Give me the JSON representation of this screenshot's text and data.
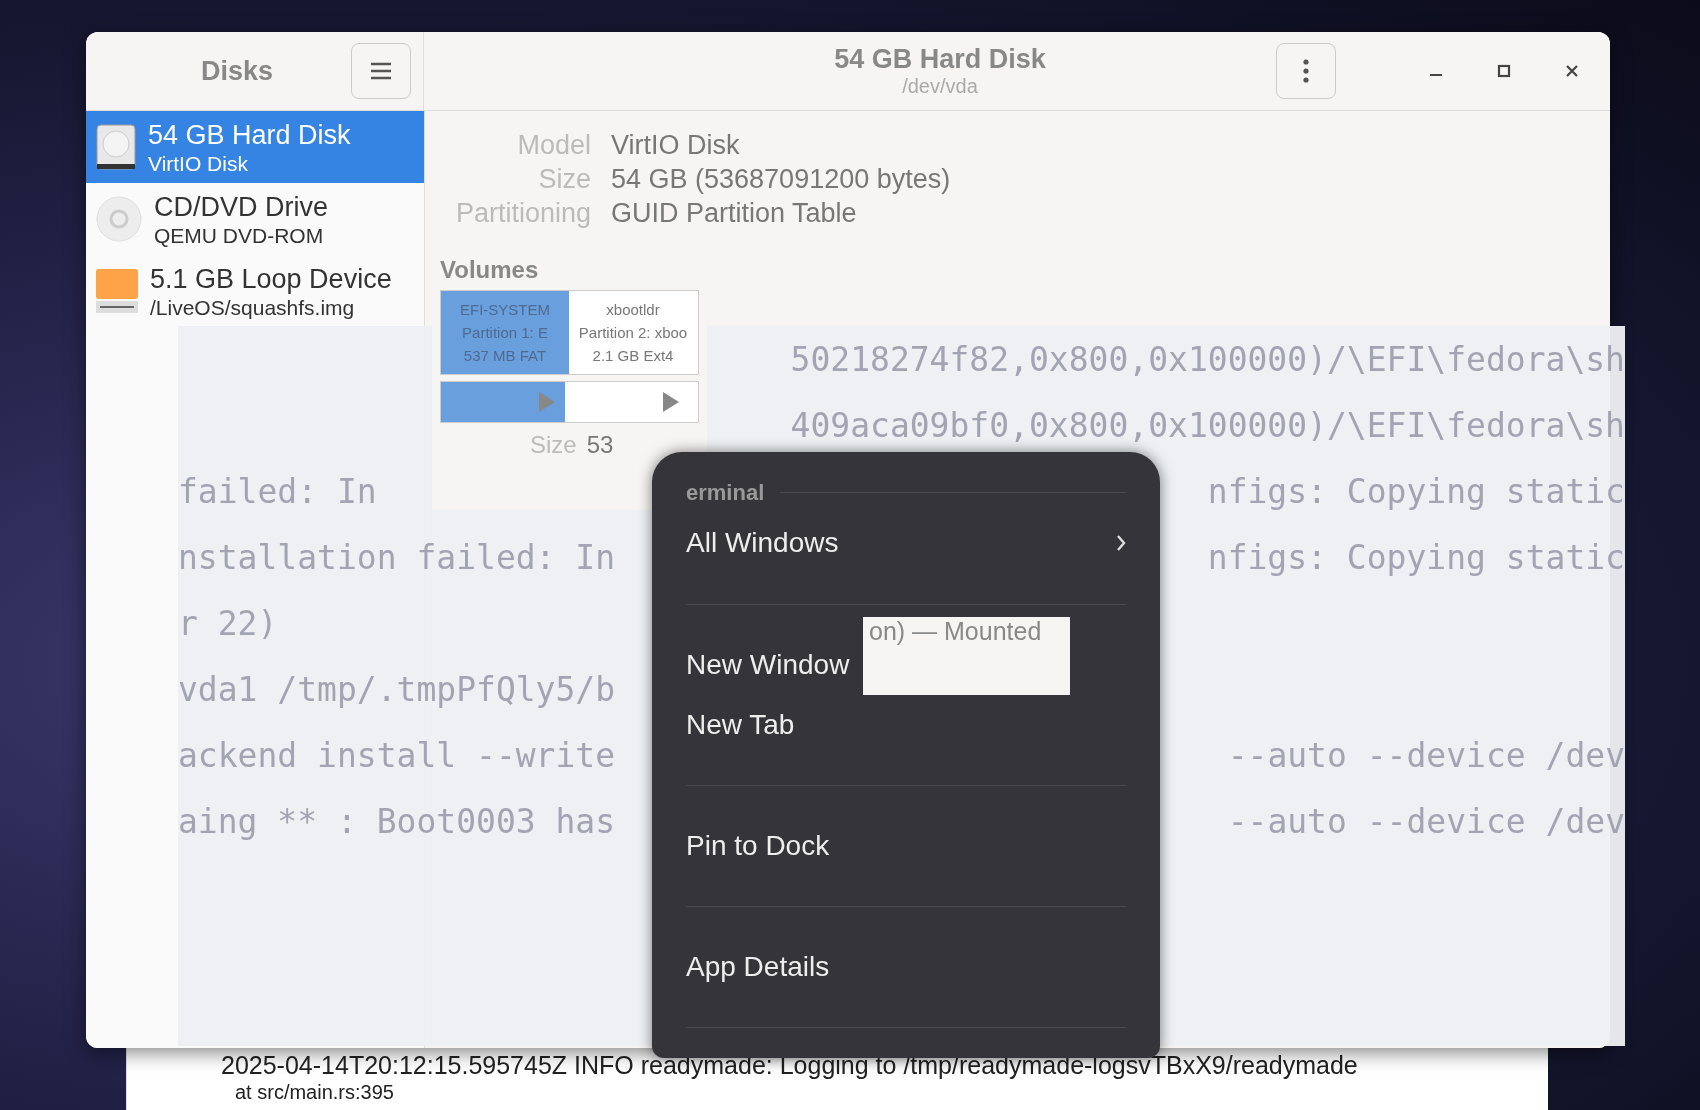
{
  "disks_window": {
    "app_title": "Disks",
    "title": "54 GB Hard Disk",
    "subtitle": "/dev/vda",
    "devices": [
      {
        "kind": "hdd",
        "name": "54 GB Hard Disk",
        "detail": "VirtIO Disk",
        "selected": true
      },
      {
        "kind": "optical",
        "name": "CD/DVD Drive",
        "detail": "QEMU DVD-ROM",
        "selected": false
      },
      {
        "kind": "loop",
        "name": "5.1 GB Loop Device",
        "detail": "/LiveOS/squashfs.img",
        "selected": false
      }
    ],
    "info": [
      {
        "label": "Model",
        "value": "VirtIO Disk"
      },
      {
        "label": "Size",
        "value": "54 GB (53687091200 bytes)"
      },
      {
        "label": "Partitioning",
        "value": "GUID Partition Table"
      }
    ],
    "volumes": {
      "heading": "Volumes",
      "partitions": [
        {
          "name": "EFI-SYSTEM",
          "line": "Partition 1: E",
          "size": "537 MB FAT",
          "selected": true
        },
        {
          "name": "xbootldr",
          "line": "Partition 2: xboo",
          "size": "2.1 GB Ext4",
          "selected": false
        }
      ]
    },
    "size_label": "Size",
    "size_value": "53",
    "mount_fragment": "on) — Mounted"
  },
  "terminal_window": {
    "lines": [
      {
        "right": "50218274f82,0x800,0x100000)/\\EFI\\fedora\\sh"
      },
      {
        "right": "409aca09bf0,0x800,0x100000)/\\EFI\\fedora\\sh"
      },
      {
        "left": "failed: In",
        "right": "nfigs: Copying static"
      },
      {
        "left": "nstallation failed: In",
        "right": "nfigs: Copying static"
      },
      {
        "left": "r 22)"
      },
      {
        "left": "vda1 /tmp/.tmpPfQly5/b"
      },
      {
        "left": "ackend install --write",
        "right": "--auto --device /dev"
      },
      {
        "left": "aing ** : Boot0003 has",
        "right": "--auto --device /dev"
      }
    ]
  },
  "dock_menu": {
    "items": [
      {
        "kind": "header",
        "label": "erminal"
      },
      {
        "kind": "submenu",
        "label": "All Windows"
      },
      {
        "kind": "separator"
      },
      {
        "kind": "item",
        "label": "New Window"
      },
      {
        "kind": "item",
        "label": "New Tab"
      },
      {
        "kind": "separator"
      },
      {
        "kind": "item",
        "label": "Pin to Dock"
      },
      {
        "kind": "separator"
      },
      {
        "kind": "item",
        "label": "App Details"
      },
      {
        "kind": "separator"
      }
    ]
  },
  "log_window": {
    "lines": [
      "2025-04-14T20:12:15.595745Z  INFO readymade: Logging to /tmp/readymade-logsvTBxX9/readymade",
      "at src/main.rs:395"
    ]
  }
}
